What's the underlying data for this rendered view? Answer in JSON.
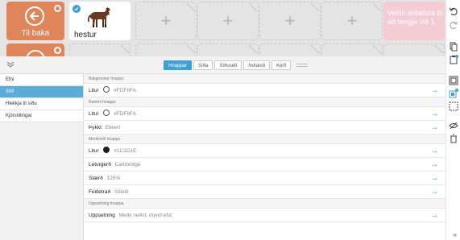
{
  "board": {
    "back_label": "Til baka",
    "word_label": "hestur",
    "pink_text": "Veldu orðalista til að tengja við 1"
  },
  "tabs": {
    "items": [
      "Hnappar",
      "Síða",
      "Síðusett",
      "Notandi",
      "Kerfi"
    ],
    "active": "Hnappar"
  },
  "sidenav": {
    "items": [
      "Efni",
      "Stíll",
      "Hlekkja til síðu",
      "Kjörstillingar"
    ],
    "active": "Stíll"
  },
  "content": {
    "bg_section": "Bakgrunnur hnapps",
    "bg_color_label": "Litur",
    "bg_color_value": "#FDF8FA",
    "frame_section": "Rammi hnapps",
    "frame_color_label": "Litur",
    "frame_color_value": "#FDF8FA",
    "frame_thickness_label": "Þykkt",
    "frame_thickness_value": "Ekkert",
    "caption_section": "Merkimiði hnapps",
    "caption_color_label": "Litur",
    "caption_color_value": "#1C1D1E",
    "font_label": "Leturgerð",
    "font_value": "Cambridge",
    "size_label": "Stærð",
    "size_value": "125%",
    "bold_label": "Feitletrað",
    "bold_value": "Slökkt",
    "layout_section": "Uppsetning hnappa",
    "layout_label": "Uppsetning",
    "layout_value": "Merki neðst, mynd efst"
  },
  "colors": {
    "accent": "#3FA0D8",
    "back_cell": "#E0855A",
    "pink_cell": "#F4CCD4",
    "bg_swatch": "#FDF8FA",
    "caption_swatch": "#1C1D1E"
  }
}
